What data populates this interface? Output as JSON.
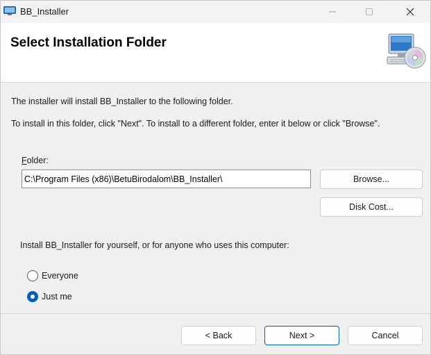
{
  "window": {
    "title": "BB_Installer"
  },
  "banner": {
    "title": "Select Installation Folder",
    "icon": "computer-cd-icon"
  },
  "intro": {
    "line1": "The installer will install BB_Installer to the following folder.",
    "line2": "To install in this folder, click \"Next\". To install to a different folder, enter it below or click \"Browse\"."
  },
  "folder": {
    "label_accel": "F",
    "label_rest": "older:",
    "value": "C:\\Program Files (x86)\\BetuBirodalom\\BB_Installer\\",
    "browse_label": "Browse...",
    "disk_cost_label": "Disk Cost..."
  },
  "install_for": {
    "prompt": "Install BB_Installer for yourself, or for anyone who uses this computer:",
    "options": [
      {
        "label": "Everyone",
        "selected": false
      },
      {
        "label": "Just me",
        "selected": true
      }
    ]
  },
  "footer": {
    "back_label": "< Back",
    "next_label": "Next >",
    "cancel_label": "Cancel"
  },
  "colors": {
    "accent": "#005fb8",
    "background": "#f0f0f0",
    "banner": "#ffffff"
  }
}
